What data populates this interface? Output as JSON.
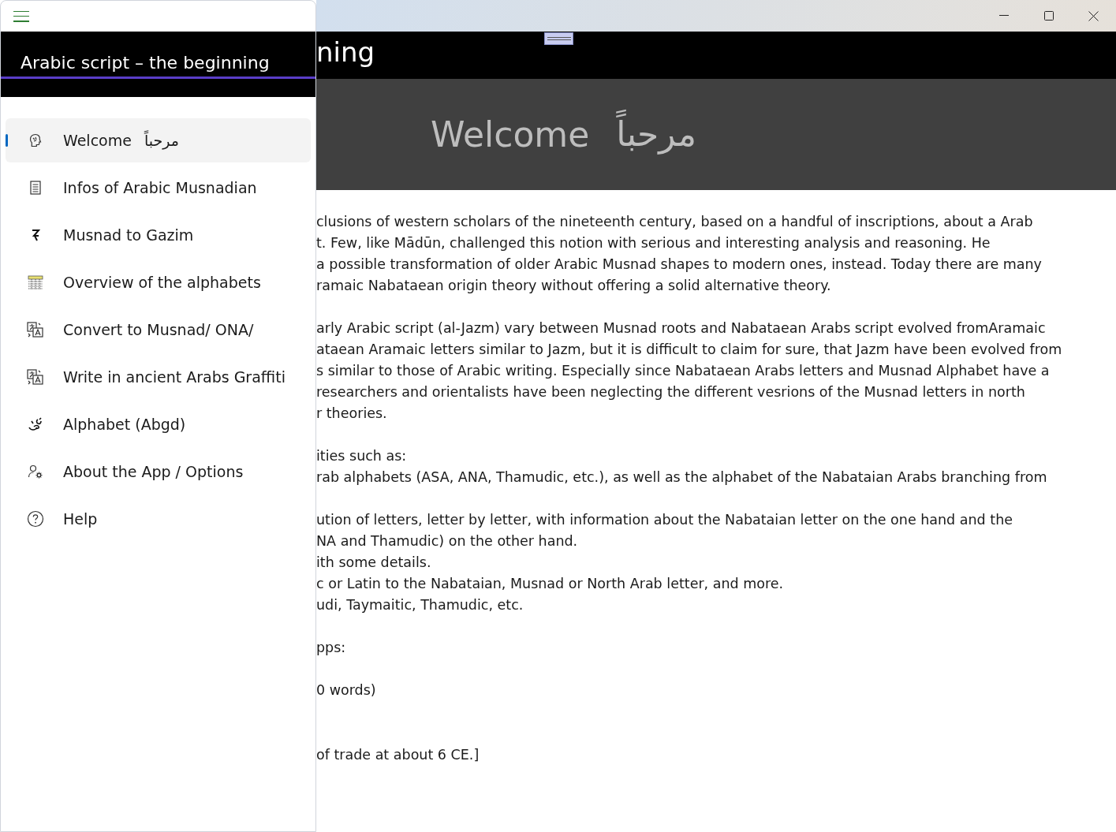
{
  "header": {
    "title_fragment": "ning"
  },
  "banner": {
    "title": "Welcome",
    "arabic": "مرحباً"
  },
  "paragraphs": [
    [
      "clusions of western scholars of the nineteenth century, based on a handful of inscriptions, about a Arab",
      "t. Few, like Mādūn, challenged this notion with serious and interesting analysis and reasoning. He",
      "a possible transformation of older Arabic Musnad shapes to modern ones, instead. Today there are many",
      "ramaic Nabataean origin theory without offering a solid alternative theory."
    ],
    [
      "arly Arabic script (al-Jazm) vary between Musnad roots and Nabataean Arabs script evolved fromAramaic",
      "ataean Aramaic letters similar to Jazm, but it is difficult to claim for sure, that Jazm have been evolved from",
      "s similar to those of Arabic writing. Especially since Nabataean Arabs letters and Musnad Alphabet have a",
      "researchers and orientalists have been neglecting the different vesrions of the Musnad letters in north",
      "r theories."
    ],
    [
      "ities such as:",
      "rab alphabets (ASA, ANA, Thamudic, etc.), as well as the alphabet of the Nabataian Arabs branching from"
    ],
    [
      "ution of letters, letter by letter, with information about the Nabataian letter on the one hand and the",
      "NA and Thamudic) on the other hand.",
      "ith some details.",
      "c or Latin to the Nabataian, Musnad or North Arab letter, and more.",
      "udi, Taymaitic, Thamudic, etc."
    ],
    [
      "pps:"
    ],
    [
      "0 words)"
    ],
    [
      "of trade at about 6 CE.]"
    ]
  ],
  "drawer": {
    "title": "Arabic script – the beginning",
    "items": [
      {
        "label": "Welcome",
        "arabic": "مرحباً",
        "selected": true
      },
      {
        "label": "Infos of Arabic Musnadian",
        "selected": false
      },
      {
        "label": "Musnad to Gazim",
        "selected": false
      },
      {
        "label": "Overview of the alphabets",
        "selected": false
      },
      {
        "label": "Convert to Musnad/ ONA/",
        "selected": false
      },
      {
        "label": "Write in ancient Arabs Graffiti",
        "selected": false
      },
      {
        "label": "Alphabet (Abgd)",
        "selected": false
      },
      {
        "label": "About the App / Options",
        "selected": false
      },
      {
        "label": "Help",
        "selected": false
      }
    ]
  }
}
